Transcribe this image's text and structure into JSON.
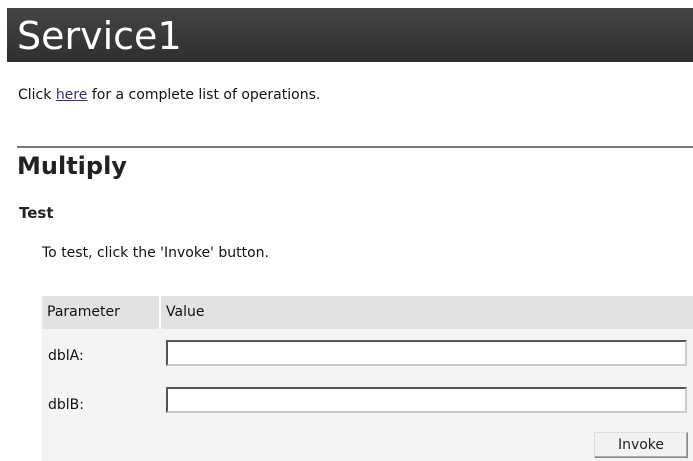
{
  "header": {
    "title": "Service1"
  },
  "intro": {
    "prefix": "Click ",
    "link_text": "here",
    "suffix": " for a complete list of operations."
  },
  "operation": {
    "name": "Multiply",
    "test_heading": "Test",
    "instructions": "To test, click the 'Invoke' button."
  },
  "parameters_table": {
    "columns": [
      "Parameter",
      "Value"
    ],
    "rows": [
      {
        "label": "dblA:",
        "value": ""
      },
      {
        "label": "dblB:",
        "value": ""
      }
    ],
    "invoke_label": "Invoke"
  },
  "colors": {
    "header_background": "#3a3a3a",
    "header_text": "#ffffff",
    "link": "#333366",
    "panel_background": "#f4f4f4",
    "table_header_background": "#e2e2e2"
  }
}
